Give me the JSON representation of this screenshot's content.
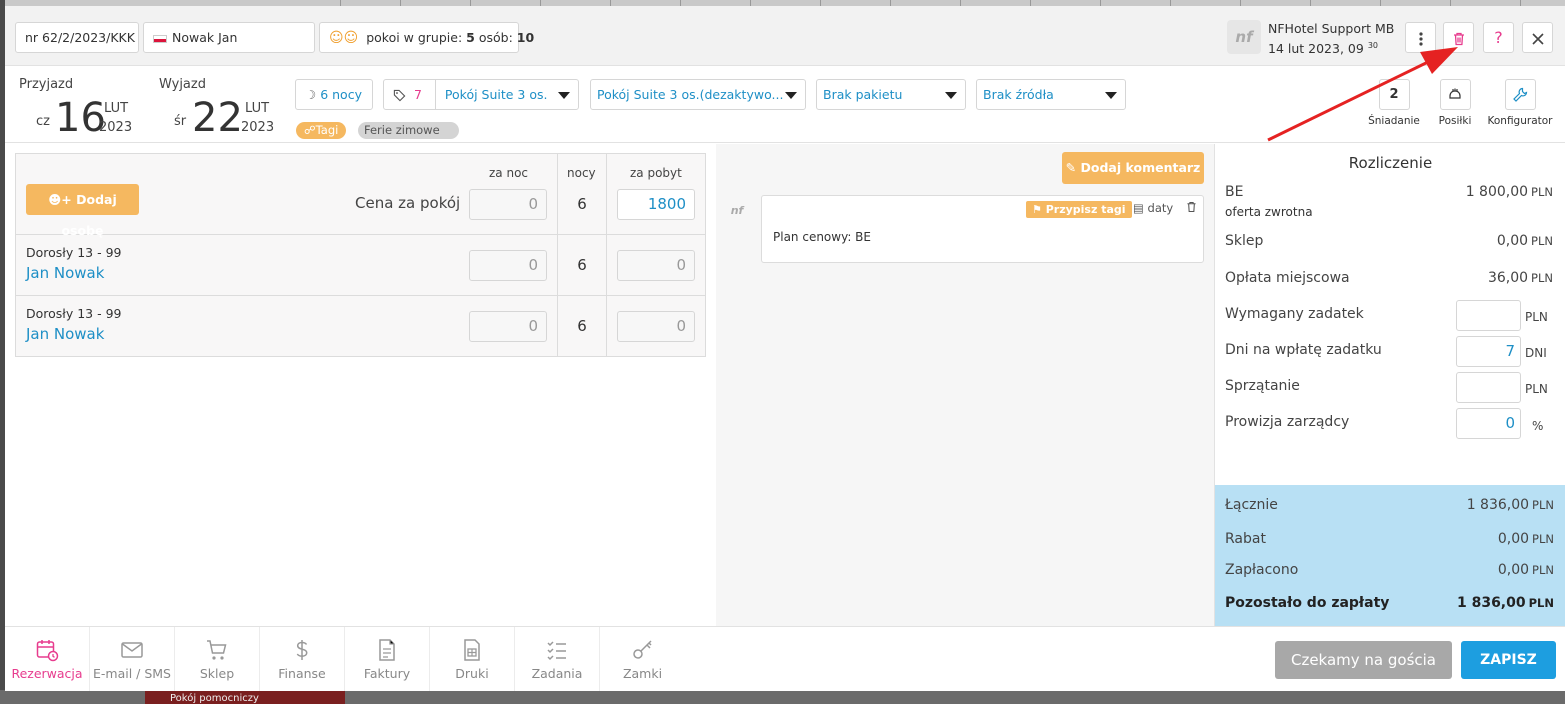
{
  "background": {
    "bottom_bar_label": "Pokój pomocniczy"
  },
  "header": {
    "reservation_number": "nr 62/2/2023/KKK",
    "guest_name": "Nowak Jan",
    "group_label": "pokoi w grupie:",
    "group_rooms": "5",
    "persons_label": "osób:",
    "group_persons": "10",
    "user_name": "NFHotel Support MB",
    "user_avatar_text": "nf",
    "user_datetime": "14 lut 2023, 09",
    "user_datetime_minutes": "30",
    "more_icon": "more-vertical-icon",
    "delete_icon": "trash-icon",
    "help_label": "?",
    "close_icon": "close-icon"
  },
  "stay": {
    "arrival_label": "Przyjazd",
    "arrival_weekday": "cz",
    "arrival_day": "16",
    "arrival_month": "LUT",
    "arrival_year": "2023",
    "departure_label": "Wyjazd",
    "departure_weekday": "śr",
    "departure_day": "22",
    "departure_month": "LUT",
    "departure_year": "2023",
    "nights_label": "6 nocy",
    "room_number": "7",
    "room_type": "Pokój Suite 3 os.",
    "room_type_disabled": "Pokój Suite 3 os.(dezaktywo...",
    "package": "Brak pakietu",
    "source": "Brak źródła",
    "tags_button": "Tagi",
    "tag": "Ferie zimowe"
  },
  "services": [
    {
      "label": "Śniadanie",
      "value": "2",
      "icon": "breakfast-icon"
    },
    {
      "label": "Posiłki",
      "value": "",
      "icon": "meals-icon"
    },
    {
      "label": "Konfigurator",
      "value": "",
      "icon": "wrench-icon"
    }
  ],
  "guests_table": {
    "add_person_label": "Dodaj osobę",
    "col_per_night": "za noc",
    "col_nights": "nocy",
    "col_per_stay": "za pobyt",
    "room_price_label": "Cena za pokój",
    "room_price": {
      "per_night": "0",
      "nights": "6",
      "per_stay": "1800"
    },
    "rows": [
      {
        "category": "Dorosły 13 - 99",
        "name": "Jan Nowak",
        "per_night": "0",
        "nights": "6",
        "per_stay": "0"
      },
      {
        "category": "Dorosły 13 - 99",
        "name": "Jan Nowak",
        "per_night": "0",
        "nights": "6",
        "per_stay": "0"
      }
    ]
  },
  "comments": {
    "add_comment_label": "Dodaj komentarz",
    "assign_tags_label": "Przypisz tagi",
    "dates_label": "daty",
    "comment_text": "Plan cenowy: BE",
    "author_avatar_text": "nf"
  },
  "billing": {
    "title": "Rozliczenie",
    "be_label": "BE",
    "be_sublabel": "oferta zwrotna",
    "be_value": "1 800,00",
    "shop_label": "Sklep",
    "shop_value": "0,00",
    "city_tax_label": "Opłata miejscowa",
    "city_tax_value": "36,00",
    "deposit_label": "Wymagany zadatek",
    "deposit_value": "",
    "deposit_days_label": "Dni na wpłatę zadatku",
    "deposit_days_value": "7",
    "days_unit": "DNI",
    "cleaning_label": "Sprzątanie",
    "cleaning_value": "",
    "commission_label": "Prowizja zarządcy",
    "commission_value": "0",
    "percent_unit": "%",
    "currency": "PLN",
    "total_label": "Łącznie",
    "total_value": "1 836,00",
    "discount_label": "Rabat",
    "discount_value": "0,00",
    "paid_label": "Zapłacono",
    "paid_value": "0,00",
    "remaining_label": "Pozostało do zapłaty",
    "remaining_value": "1 836,00"
  },
  "footer": {
    "tabs": [
      {
        "label": "Rezerwacja",
        "icon": "calendar-clock-icon",
        "active": true
      },
      {
        "label": "E-mail / SMS",
        "icon": "envelope-icon"
      },
      {
        "label": "Sklep",
        "icon": "cart-icon"
      },
      {
        "label": "Finanse",
        "icon": "dollar-icon"
      },
      {
        "label": "Faktury",
        "icon": "invoice-icon"
      },
      {
        "label": "Druki",
        "icon": "print-doc-icon"
      },
      {
        "label": "Zadania",
        "icon": "checklist-icon"
      },
      {
        "label": "Zamki",
        "icon": "key-icon"
      }
    ],
    "waiting_button": "Czekamy na gościa",
    "save_button": "ZAPISZ"
  },
  "colors": {
    "accent_blue": "#1e8fc6",
    "orange": "#f5b860",
    "active_pink": "#e73c8e",
    "summary_bg": "#b8e0f4",
    "save_bg": "#1d9ee0",
    "annotation_arrow": "#e52222"
  }
}
